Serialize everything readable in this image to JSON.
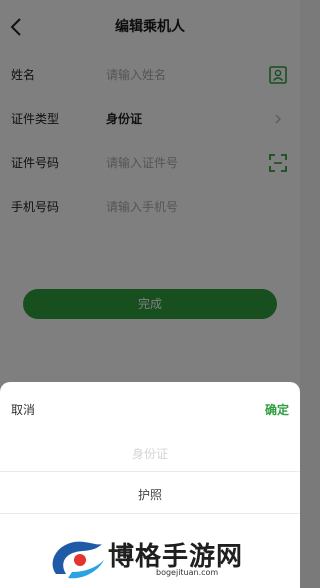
{
  "nav": {
    "title": "编辑乘机人",
    "back_icon": "chevron-left-icon"
  },
  "form": {
    "name": {
      "label": "姓名",
      "placeholder": "请输入姓名",
      "icon": "contact-card-icon"
    },
    "id_type": {
      "label": "证件类型",
      "value": "身份证",
      "icon": "chevron-right-icon"
    },
    "id_number": {
      "label": "证件号码",
      "placeholder": "请输入证件号",
      "icon": "scan-icon"
    },
    "phone": {
      "label": "手机号码",
      "placeholder": "请输入手机号"
    }
  },
  "done_button": "完成",
  "picker": {
    "cancel": "取消",
    "confirm": "确定",
    "options": [
      "身份证",
      "护照"
    ]
  },
  "watermark": {
    "text": "博格手游网",
    "sub": "bogejituan.com"
  },
  "colors": {
    "accent": "#2f9e3e",
    "overlay": "rgba(0,0,0,0.5)"
  }
}
